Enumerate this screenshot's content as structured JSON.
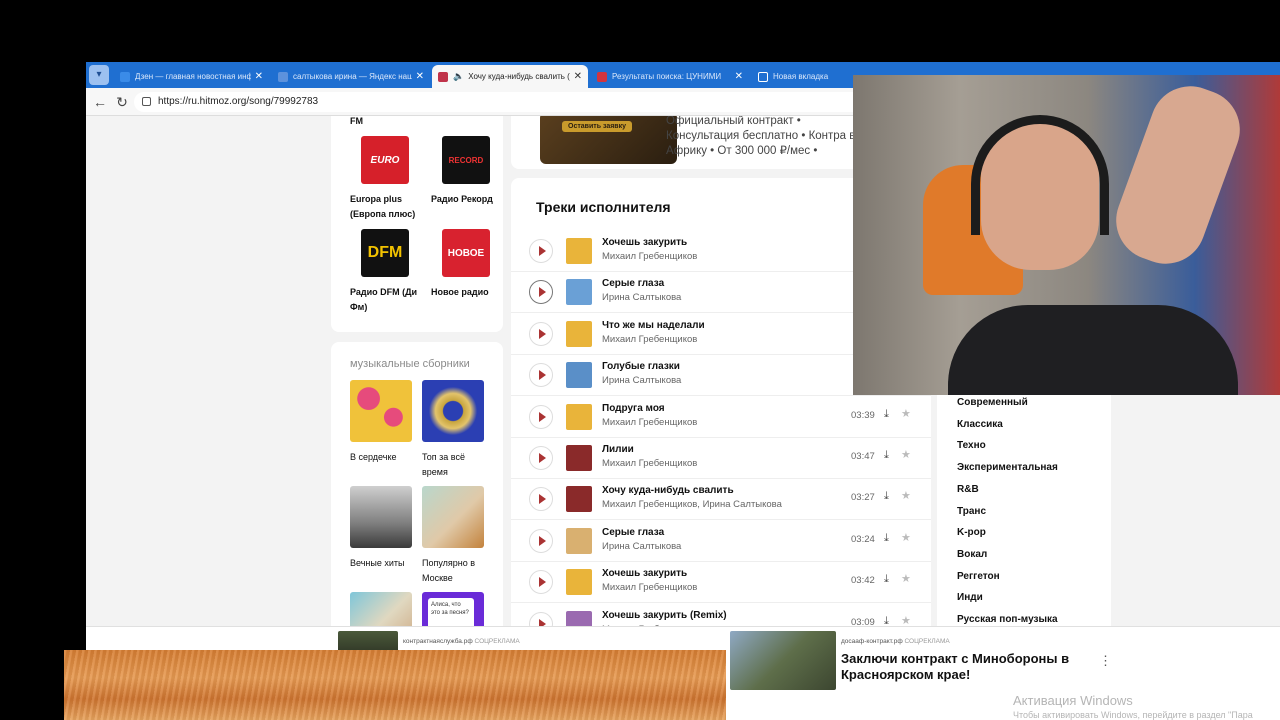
{
  "browser": {
    "tabs": [
      {
        "label": "Дзен — главная новостная инф",
        "active": false
      },
      {
        "label": "салтыкова ирина — Яндекс нашё",
        "active": false
      },
      {
        "label": "Хочу куда-нибудь свалить (I",
        "active": true
      },
      {
        "label": "Результаты поиска: ЦУНИМИ",
        "active": false
      },
      {
        "label": "Новая вкладка",
        "active": false
      }
    ],
    "url": "https://ru.hitmoz.org/song/79992783"
  },
  "radio": {
    "top_label": "FM",
    "stations": [
      {
        "name": "Europa plus (Европа плюс)"
      },
      {
        "name": "Радио Рекорд"
      },
      {
        "name": "Радио DFM (Ди Фм)"
      },
      {
        "name": "Новое радио"
      }
    ]
  },
  "compilations": {
    "title": "музыкальные сборники",
    "items": [
      {
        "name": "В сердечке"
      },
      {
        "name": "Топ за всё время"
      },
      {
        "name": "Вечные хиты"
      },
      {
        "name": "Популярно в Москве"
      },
      {
        "name": ""
      },
      {
        "name": "Алиса, что это за песня?"
      }
    ]
  },
  "banner": {
    "button": "Оставить заявку",
    "text": "Официальный контракт • Консультация бесплатно • Контра в Африку • От 300 000 ₽/мес •"
  },
  "tracks": {
    "title": "Треки исполнителя",
    "items": [
      {
        "title": "Хочешь закурить",
        "artist": "Михаил Гребенщиков",
        "duration": ""
      },
      {
        "title": "Серые глаза",
        "artist": "Ирина Салтыкова",
        "duration": ""
      },
      {
        "title": "Что же мы наделали",
        "artist": "Михаил Гребенщиков",
        "duration": ""
      },
      {
        "title": "Голубые глазки",
        "artist": "Ирина Салтыкова",
        "duration": ""
      },
      {
        "title": "Подруга моя",
        "artist": "Михаил Гребенщиков",
        "duration": "03:39"
      },
      {
        "title": "Лилии",
        "artist": "Михаил Гребенщиков",
        "duration": "03:47"
      },
      {
        "title": "Хочу куда-нибудь свалить",
        "artist": "Михаил Гребенщиков, Ирина Салтыкова",
        "duration": "03:27"
      },
      {
        "title": "Серые глаза",
        "artist": "Ирина Салтыкова",
        "duration": "03:24"
      },
      {
        "title": "Хочешь закурить",
        "artist": "Михаил Гребенщиков",
        "duration": "03:42"
      },
      {
        "title": "Хочешь закурить (Remix)",
        "artist": "Михаил Гребенщиков",
        "duration": "03:09"
      }
    ]
  },
  "genres": [
    "Современный",
    "Классика",
    "Техно",
    "Экспериментальная",
    "R&B",
    "Транс",
    "K-pop",
    "Вокал",
    "Реггетон",
    "Инди",
    "Русская поп-музыка"
  ],
  "ads": {
    "left_source": "контрактнаяслужба.рф",
    "left_label": "СОЦРЕКЛАМА",
    "right_source": "досааф-контракт.рф",
    "right_label": "СОЦРЕКЛАМА",
    "headline": "Заключи контракт с Минобороны в Красноярском крае!"
  },
  "windows_watermark": {
    "title": "Активация Windows",
    "subtitle": "Чтобы активировать Windows, перейдите в раздел \"Пара"
  },
  "colors": {
    "accent": "#1f6fd1",
    "play": "#a33333"
  }
}
